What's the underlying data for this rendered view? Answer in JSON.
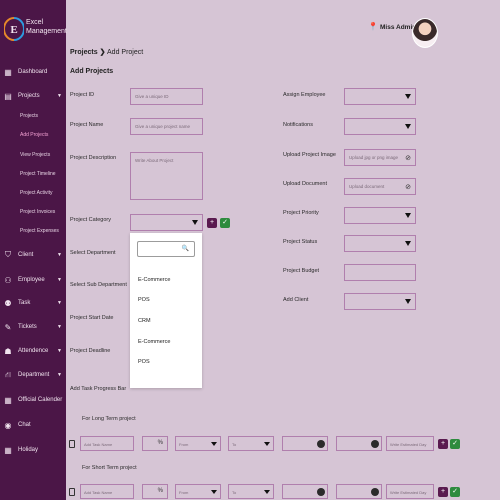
{
  "brand": {
    "line1": "Excel",
    "line2": "Management"
  },
  "sidebar": {
    "items": [
      {
        "label": "Dashboard",
        "icon": "grid-icon",
        "glyph": "▦"
      },
      {
        "label": "Projects",
        "icon": "file-icon",
        "glyph": "▤"
      },
      {
        "label": "Client",
        "icon": "handshake-icon",
        "glyph": "⛉"
      },
      {
        "label": "Employee",
        "icon": "users-icon",
        "glyph": "⚇"
      },
      {
        "label": "Task",
        "icon": "team-icon",
        "glyph": "⚉"
      },
      {
        "label": "Tickets",
        "icon": "ticket-icon",
        "glyph": "✎"
      },
      {
        "label": "Attendence",
        "icon": "fingerprint-icon",
        "glyph": "☗"
      },
      {
        "label": "Department",
        "icon": "sitemap-icon",
        "glyph": "⛙"
      },
      {
        "label": "Official Calender",
        "icon": "calendar-icon",
        "glyph": "▦"
      },
      {
        "label": "Chat",
        "icon": "chat-icon",
        "glyph": "◉"
      },
      {
        "label": "Holiday",
        "icon": "holiday-calendar-icon",
        "glyph": "▦"
      }
    ],
    "sub_items": [
      "Projects",
      "Add Projects",
      "View Projects",
      "Project Timeline",
      "Project Activity",
      "Project Invoices",
      "Project Expenses"
    ]
  },
  "header": {
    "admin_name": "Miss Admin"
  },
  "breadcrumb": {
    "root": "Projects",
    "sep": "❯",
    "current": "Add Project"
  },
  "page_title": "Add Projects",
  "form": {
    "project_id": {
      "label": "Project ID",
      "placeholder": "Give a unique ID"
    },
    "project_name": {
      "label": "Project Name",
      "placeholder": "Give a unique project name"
    },
    "project_description": {
      "label": "Project Description",
      "placeholder": "Write About Project"
    },
    "project_category": {
      "label": "Project Category"
    },
    "select_department": {
      "label": "Select Department"
    },
    "select_sub_department": {
      "label": "Select Sub Department"
    },
    "project_start_date": {
      "label": "Project Start Date"
    },
    "project_deadline": {
      "label": "Project Deadline"
    },
    "assign_employee": {
      "label": "Assign Employee"
    },
    "notifications": {
      "label": "Notifications"
    },
    "upload_project_image": {
      "label": "Upload Project Image",
      "placeholder": "Upload jpg or png image"
    },
    "upload_document": {
      "label": "Upload Document",
      "placeholder": "Upload document"
    },
    "project_priority": {
      "label": "Project Priority"
    },
    "project_status": {
      "label": "Project Status"
    },
    "project_budget": {
      "label": "Project Budget"
    },
    "add_client": {
      "label": "Add Client"
    },
    "add_button": "+",
    "confirm_button": "✓"
  },
  "dropdown": {
    "options": [
      "E-Commerce",
      "POS",
      "CRM",
      "E-Commerce",
      "POS"
    ]
  },
  "progress": {
    "title": "Add Task Progress Bar",
    "long_term_label": "For Long Term project",
    "short_term_label": "For Short Term project",
    "task_name_placeholder": "Add Task Name",
    "percent_suffix": "%",
    "from_placeholder": "From",
    "to_placeholder": "To",
    "estimate_placeholder": "Write Estimated Day",
    "add_button": "+",
    "confirm_button": "✓"
  }
}
